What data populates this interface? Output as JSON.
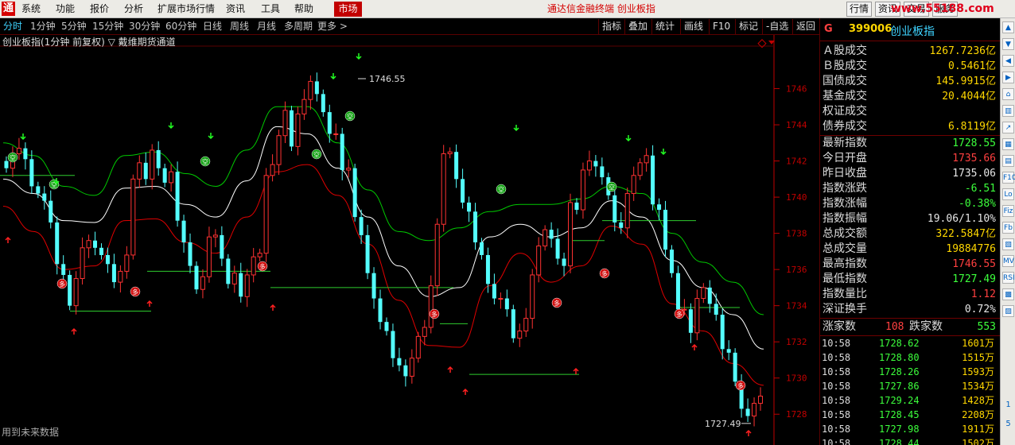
{
  "menubar": {
    "logo": "通",
    "items": [
      "系统",
      "功能",
      "报价",
      "分析",
      "扩展市场行情",
      "资讯",
      "工具",
      "帮助"
    ],
    "active": "市场",
    "title": "通达信金融终端  创业板指",
    "right_buttons": [
      "行情",
      "资讯",
      "交易",
      "服务"
    ],
    "watermark": "www.55188.com"
  },
  "periodbar": {
    "periods": [
      "分时",
      "1分钟",
      "5分钟",
      "15分钟",
      "30分钟",
      "60分钟",
      "日线",
      "周线",
      "月线",
      "多周期",
      "更多 >"
    ],
    "active_index": 0,
    "tools": [
      "指标",
      "叠加",
      "统计",
      "画线",
      "F10",
      "标记",
      "-自选",
      "返回"
    ]
  },
  "chart": {
    "title": "创业板指(1分钟 前复权) ▽ 戴维期货通道",
    "footer": "用到未来数据",
    "high_label": "1746.55",
    "low_label": "1727.49",
    "signal_sell": "空",
    "signal_buy": "多",
    "colors": {
      "up": "#ff3232",
      "down": "#54ffff",
      "mid": "#ffffff",
      "upper": "#00c800",
      "lower": "#e00000",
      "axis": "#c00000"
    }
  },
  "chart_data": {
    "type": "candlestick",
    "title": "创业板指(1分钟 前复权)",
    "indicator": "戴维期货通道",
    "ylim": [
      1727,
      1748
    ],
    "y_ticks": [
      1728,
      1730,
      1732,
      1734,
      1736,
      1738,
      1740,
      1742,
      1744,
      1746
    ],
    "high": 1746.55,
    "low": 1727.49,
    "channel": {
      "mid": [
        1741.0,
        1740.2,
        1738.7,
        1738.6,
        1740.5,
        1740.6,
        1739.6,
        1738.9,
        1740.9,
        1743.9,
        1743.5,
        1741.6,
        1738.9,
        1736.2,
        1734.5,
        1735.0,
        1737.8,
        1738.5,
        1737.8,
        1738.3,
        1739.8,
        1738.9,
        1736.5,
        1735.0,
        1733.5,
        1731.6
      ],
      "upper": [
        1743.0,
        1742.3,
        1740.6,
        1740.1,
        1742.3,
        1742.5,
        1741.3,
        1740.6,
        1742.6,
        1745.0,
        1745.0,
        1743.0,
        1740.4,
        1738.1,
        1737.6,
        1738.3,
        1739.2,
        1739.6,
        1739.6,
        1739.9,
        1740.6,
        1740.2,
        1738.0,
        1736.4,
        1735.3,
        1733.5
      ],
      "lower": [
        1739.5,
        1738.1,
        1736.0,
        1736.2,
        1738.7,
        1738.8,
        1737.5,
        1736.9,
        1738.9,
        1741.4,
        1741.8,
        1740.1,
        1737.4,
        1734.3,
        1731.8,
        1731.7,
        1735.1,
        1736.9,
        1735.3,
        1736.2,
        1738.4,
        1737.4,
        1734.1,
        1732.6,
        1730.8,
        1729.6
      ]
    },
    "x_fraction": [
      0,
      0.04,
      0.08,
      0.12,
      0.16,
      0.2,
      0.24,
      0.28,
      0.32,
      0.36,
      0.4,
      0.44,
      0.48,
      0.52,
      0.56,
      0.6,
      0.64,
      0.68,
      0.72,
      0.76,
      0.8,
      0.84,
      0.88,
      0.92,
      0.96,
      1.0
    ],
    "closes": [
      1741.6,
      1742.4,
      1742.7,
      1742.1,
      1740.6,
      1740.2,
      1739.8,
      1738.6,
      1736.3,
      1735.7,
      1734.0,
      1735.5,
      1737.2,
      1737.6,
      1737.2,
      1736.8,
      1736.3,
      1735.3,
      1735.9,
      1736.8,
      1741.0,
      1741.9,
      1741.0,
      1742.6,
      1741.6,
      1740.8,
      1741.4,
      1738.7,
      1737.5,
      1736.2,
      1734.9,
      1735.6,
      1737.8,
      1737.9,
      1736.6,
      1735.2,
      1735.8,
      1734.5,
      1735.7,
      1736.7,
      1736.9,
      1741.2,
      1741.8,
      1743.4,
      1744.8,
      1742.8,
      1744.6,
      1745.4,
      1746.4,
      1745.7,
      1744.7,
      1743.5,
      1743.5,
      1741.5,
      1741.6,
      1738.9,
      1737.9,
      1735.8,
      1734.4,
      1733.1,
      1732.6,
      1731.1,
      1730.7,
      1730.1,
      1731.1,
      1732.3,
      1732.8,
      1735.1,
      1738.5,
      1742.4,
      1742.5,
      1741.0,
      1739.7,
      1739.2,
      1737.5,
      1736.8,
      1735.2,
      1734.4,
      1734.4,
      1733.8,
      1732.2,
      1732.6,
      1733.3,
      1735.7,
      1737.3,
      1738.2,
      1737.7,
      1736.6,
      1736.2,
      1739.7,
      1739.3,
      1741.5,
      1742.0,
      1741.7,
      1741.1,
      1740.1,
      1738.6,
      1738.3,
      1740.2,
      1741.2,
      1741.9,
      1742.3,
      1739.6,
      1739.3,
      1737.1,
      1735.8,
      1733.8,
      1733.8,
      1732.5,
      1734.4,
      1735.0,
      1734.1,
      1733.5,
      1731.6,
      1731.4,
      1729.8,
      1728.3,
      1727.9,
      1728.6,
      1729.0
    ]
  },
  "panel": {
    "g": "G",
    "code": "399006",
    "name": "创业板指",
    "rows": [
      {
        "label": "Ａ股成交",
        "value": "1267.7236亿",
        "color": "#ffd700"
      },
      {
        "label": "Ｂ股成交",
        "value": "0.5461亿",
        "color": "#ffd700"
      },
      {
        "label": "国债成交",
        "value": "145.9915亿",
        "color": "#ffd700"
      },
      {
        "label": "基金成交",
        "value": "20.4044亿",
        "color": "#ffd700"
      },
      {
        "label": "权证成交",
        "value": "",
        "color": "#ffd700"
      },
      {
        "label": "债券成交",
        "value": "6.8119亿",
        "color": "#ffd700"
      }
    ],
    "rows2": [
      {
        "label": "最新指数",
        "value": "1728.55",
        "color": "#3cff3c"
      },
      {
        "label": "今日开盘",
        "value": "1735.66",
        "color": "#ff4040"
      },
      {
        "label": "昨日收盘",
        "value": "1735.06",
        "color": "#e6e6e6"
      },
      {
        "label": "指数涨跌",
        "value": "-6.51",
        "color": "#3cff3c"
      },
      {
        "label": "指数涨幅",
        "value": "-0.38%",
        "color": "#3cff3c"
      },
      {
        "label": "指数振幅",
        "value": "19.06/1.10%",
        "color": "#e6e6e6"
      },
      {
        "label": "总成交额",
        "value": "322.5847亿",
        "color": "#ffd700"
      },
      {
        "label": "总成交量",
        "value": "19884776",
        "color": "#ffd700"
      },
      {
        "label": "最高指数",
        "value": "1746.55",
        "color": "#ff4040"
      },
      {
        "label": "最低指数",
        "value": "1727.49",
        "color": "#3cff3c"
      },
      {
        "label": "指数量比",
        "value": "1.12",
        "color": "#ff4040"
      },
      {
        "label": "深证换手",
        "value": "0.72%",
        "color": "#e6e6e6"
      }
    ],
    "advdec": {
      "up_label": "涨家数",
      "up": "108",
      "down_label": "跌家数",
      "down": "553"
    },
    "ticks": [
      {
        "time": "10:58",
        "price": "1728.62",
        "vol": "1601万"
      },
      {
        "time": "10:58",
        "price": "1728.80",
        "vol": "1515万"
      },
      {
        "time": "10:58",
        "price": "1728.26",
        "vol": "1593万"
      },
      {
        "time": "10:58",
        "price": "1727.86",
        "vol": "1534万"
      },
      {
        "time": "10:58",
        "price": "1729.24",
        "vol": "1428万"
      },
      {
        "time": "10:58",
        "price": "1728.45",
        "vol": "2208万"
      },
      {
        "time": "10:58",
        "price": "1727.98",
        "vol": "1911万"
      },
      {
        "time": "10:58",
        "price": "1728.44",
        "vol": "1502万"
      }
    ]
  },
  "sidebar": {
    "icons": [
      "arrow-up-icon",
      "arrow-down-icon",
      "left-icon",
      "right-icon",
      "chart-icon",
      "candle-icon",
      "line-icon",
      "bar-icon",
      "grid-icon",
      "f10-icon",
      "lo-icon",
      "fiz-icon",
      "fb-icon",
      "cr-icon",
      "mv-icon",
      "rsi-icon",
      "vol-icon",
      "macd-icon"
    ],
    "labels": [
      "▲",
      "▼",
      "◀",
      "▶",
      "⌂",
      "▥",
      "↗",
      "▦",
      "▤",
      "F10",
      "Lo",
      "Fiz",
      "Fb",
      "▧",
      "MV",
      "RSI",
      "▩",
      "▨"
    ],
    "nums": [
      "1",
      "5"
    ]
  }
}
